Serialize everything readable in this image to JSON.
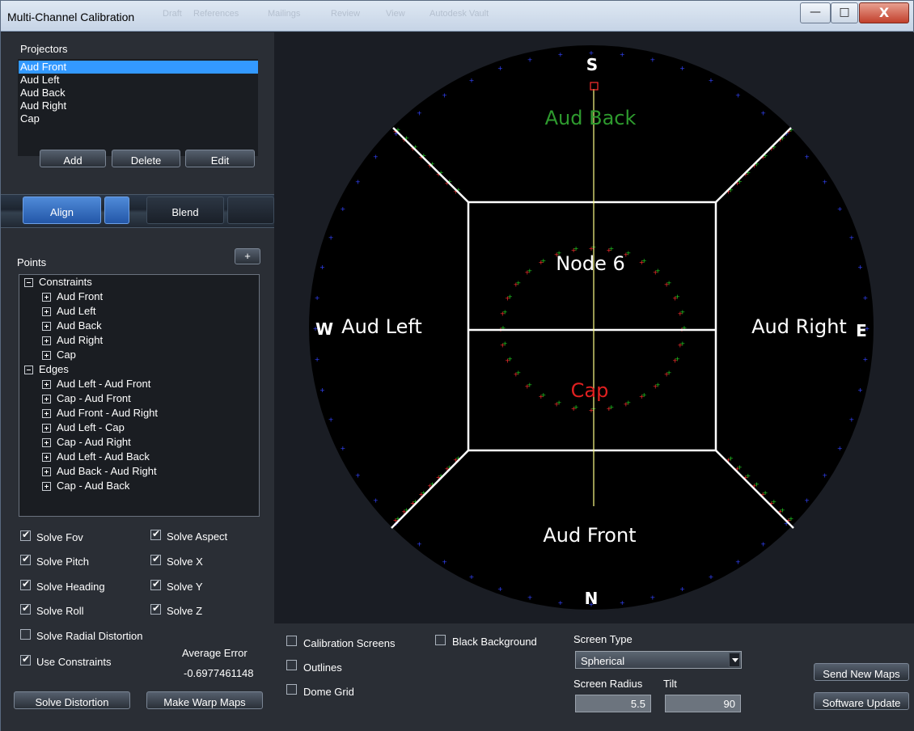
{
  "window": {
    "title": "Multi-Channel Calibration",
    "background_menu": [
      "Draft",
      "References",
      "Mailings",
      "Review",
      "View",
      "Autodesk Vault"
    ],
    "controls": {
      "minimize": "—",
      "maximize": "□",
      "close": "X"
    }
  },
  "projectors": {
    "label": "Projectors",
    "items": [
      "Aud Front",
      "Aud Left",
      "Aud Back",
      "Aud Right",
      "Cap"
    ],
    "selected": "Aud Front",
    "buttons": {
      "add": "Add",
      "delete": "Delete",
      "edit": "Edit"
    }
  },
  "tabs": {
    "align": "Align",
    "blend": "Blend"
  },
  "points": {
    "label": "Points",
    "add_button": "+",
    "tree": [
      {
        "label": "Constraints",
        "expanded": true,
        "children": [
          "Aud Front",
          "Aud Left",
          "Aud Back",
          "Aud Right",
          "Cap"
        ]
      },
      {
        "label": "Edges",
        "expanded": true,
        "children": [
          "Aud Left - Aud Front",
          "Cap - Aud Front",
          "Aud Front - Aud Right",
          "Aud Left - Cap",
          "Cap - Aud Right",
          "Aud Left - Aud Back",
          "Aud Back - Aud Right",
          "Cap - Aud Back"
        ]
      }
    ]
  },
  "solve_options": {
    "left": [
      {
        "label": "Solve Fov",
        "checked": true
      },
      {
        "label": "Solve Pitch",
        "checked": true
      },
      {
        "label": "Solve Heading",
        "checked": true
      },
      {
        "label": "Solve Roll",
        "checked": true
      },
      {
        "label": "Solve Radial Distortion",
        "checked": false
      },
      {
        "label": "Use Constraints",
        "checked": true
      }
    ],
    "right": [
      {
        "label": "Solve Aspect",
        "checked": true
      },
      {
        "label": "Solve X",
        "checked": true
      },
      {
        "label": "Solve Y",
        "checked": true
      },
      {
        "label": "Solve Z",
        "checked": true
      }
    ]
  },
  "average_error": {
    "label": "Average Error",
    "value": "-0.6977461148"
  },
  "actions": {
    "solve_distortion": "Solve Distortion",
    "make_warp_maps": "Make Warp Maps"
  },
  "viewport": {
    "compass": {
      "north": "N",
      "south": "S",
      "east": "E",
      "west": "W"
    },
    "regions": {
      "aud_back": "Aud Back",
      "aud_left": "Aud Left",
      "aud_right": "Aud Right",
      "aud_front": "Aud Front",
      "node": "Node 6",
      "cap": "Cap"
    },
    "colors": {
      "dome": "#000000",
      "viewport_bg": "#1a1d24",
      "grid_lines": "#ffffff",
      "centerline": "#ffff88",
      "aud_back_label": "#2e9a2e",
      "cap_label": "#e02020",
      "point_red": "#ff3030",
      "point_green": "#22cc22",
      "rim_marker": "#3344ff"
    }
  },
  "display_options": [
    {
      "label": "Calibration Screens",
      "checked": false
    },
    {
      "label": "Outlines",
      "checked": false
    },
    {
      "label": "Dome Grid",
      "checked": false
    },
    {
      "label": "Black Background",
      "checked": false
    }
  ],
  "screen": {
    "type_label": "Screen Type",
    "type_value": "Spherical",
    "radius_label": "Screen Radius",
    "radius_value": "5.5",
    "tilt_label": "Tilt",
    "tilt_value": "90"
  },
  "right_buttons": {
    "send_new_maps": "Send New Maps",
    "software_update": "Software Update"
  }
}
